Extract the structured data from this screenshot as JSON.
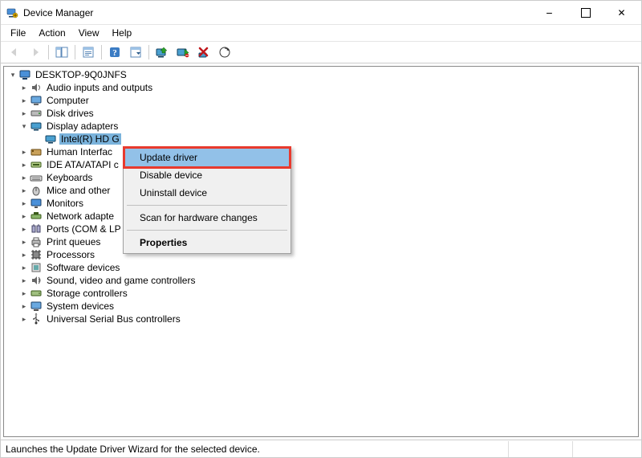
{
  "window": {
    "title": "Device Manager"
  },
  "menubar": {
    "file": "File",
    "action": "Action",
    "view": "View",
    "help": "Help"
  },
  "tree": {
    "root": "DESKTOP-9Q0JNFS",
    "audio": "Audio inputs and outputs",
    "computer": "Computer",
    "disk": "Disk drives",
    "display": "Display adapters",
    "display_child": "Intel(R) HD G",
    "hid": "Human Interfac",
    "ide": "IDE ATA/ATAPI c",
    "keyboards": "Keyboards",
    "mice": "Mice and other ",
    "monitors": "Monitors",
    "network": "Network adapte",
    "ports": "Ports (COM & LP",
    "print": "Print queues",
    "processors": "Processors",
    "software": "Software devices",
    "sound": "Sound, video and game controllers",
    "storage": "Storage controllers",
    "system": "System devices",
    "usb": "Universal Serial Bus controllers"
  },
  "context_menu": {
    "update": "Update driver",
    "disable": "Disable device",
    "uninstall": "Uninstall device",
    "scan": "Scan for hardware changes",
    "properties": "Properties"
  },
  "statusbar": {
    "text": "Launches the Update Driver Wizard for the selected device."
  }
}
